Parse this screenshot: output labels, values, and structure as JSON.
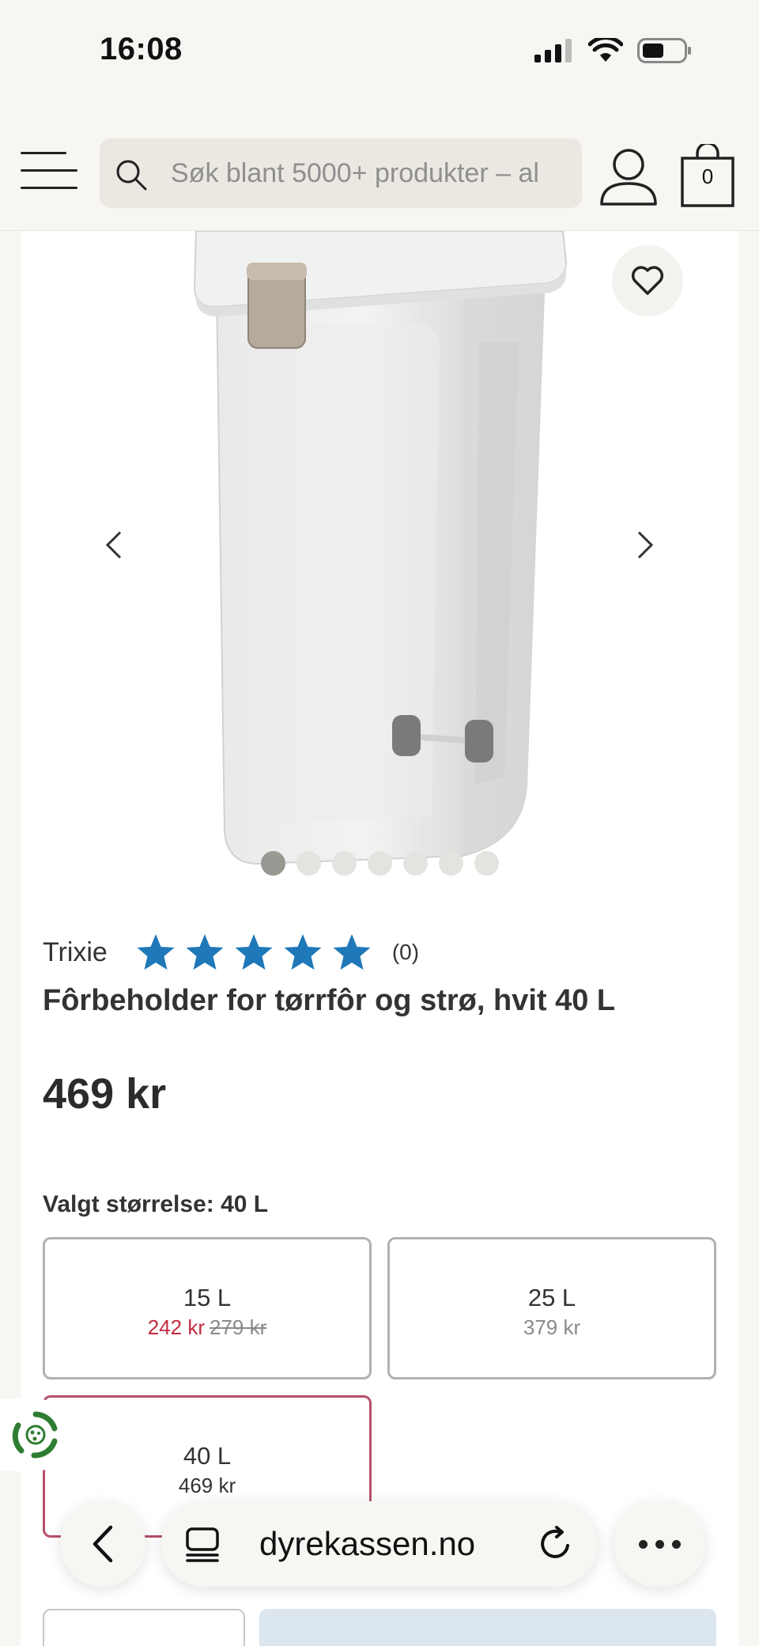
{
  "status_bar": {
    "time": "16:08"
  },
  "header": {
    "search_placeholder": "Søk blant 5000+ produkter – al",
    "cart_count": "0"
  },
  "product": {
    "brand": "Trixie",
    "rating_stars": 5,
    "rating_count": "(0)",
    "title": "Fôrbeholder for tørrfôr og strø, hvit 40 L",
    "price": "469 kr",
    "gallery_images": 7,
    "gallery_active_index": 0,
    "size_label": "Valgt størrelse: 40 L",
    "sizes": [
      {
        "name": "15 L",
        "sale_price": "242 kr",
        "old_price": "279 kr"
      },
      {
        "name": "25 L",
        "price": "379 kr"
      },
      {
        "name": "40 L",
        "price": "469 kr",
        "selected": true
      }
    ]
  },
  "browser": {
    "url": "dyrekassen.no"
  },
  "colors": {
    "star": "#1f78b8",
    "sale": "#c32a3f",
    "selected_border": "#b7506a",
    "background": "#f7f6f3"
  }
}
